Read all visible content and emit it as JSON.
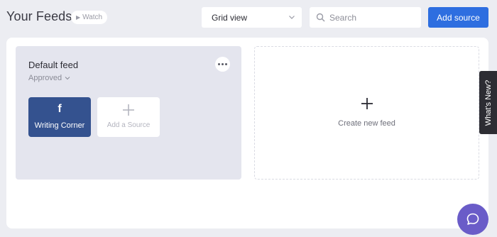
{
  "header": {
    "title": "Your Feeds",
    "watch_label": "Watch",
    "view_select": {
      "selected": "Grid view"
    },
    "search": {
      "placeholder": "Search",
      "value": ""
    },
    "add_source_label": "Add source"
  },
  "feeds": [
    {
      "name": "Default feed",
      "status": "Approved",
      "sources": [
        {
          "label": "Writing Corner",
          "icon": "facebook-icon",
          "glyph": "f",
          "color": "#34528f"
        }
      ],
      "add_source_label": "Add a Source"
    }
  ],
  "create_feed_label": "Create new feed",
  "whats_new_label": "What's New?",
  "colors": {
    "accent": "#2e6ee0",
    "facebook": "#34528f",
    "chat": "#6a5cc8",
    "background": "#ecedf2"
  },
  "icons": {
    "watch": "play-icon",
    "view_select": "chevron-down-icon",
    "search": "search-icon",
    "feed_menu": "more-horizontal-icon",
    "add_source": "plus-icon",
    "create_feed": "plus-icon",
    "chat": "chat-bubble-icon"
  }
}
